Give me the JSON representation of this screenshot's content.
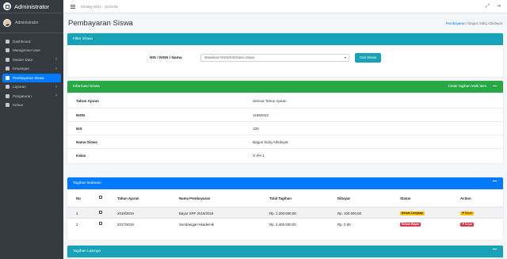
{
  "sidebar": {
    "brand": "Administrator",
    "user": "Administrator",
    "items": [
      {
        "label": "Dashboard",
        "has_chevron": false
      },
      {
        "label": "Manajemen User",
        "has_chevron": false
      },
      {
        "label": "Master Data",
        "has_chevron": true
      },
      {
        "label": "Keuangan",
        "has_chevron": true
      },
      {
        "label": "Pembayaran Siswa",
        "has_chevron": false,
        "active": true
      },
      {
        "label": "Laporan",
        "has_chevron": true
      },
      {
        "label": "Pengaturan",
        "has_chevron": true
      },
      {
        "label": "Keluar",
        "has_chevron": false
      }
    ]
  },
  "topbar": {
    "datetime": "28-May-2021 - 19:04:08",
    "expand_icon": "⤢",
    "logout_icon": "⇥"
  },
  "page": {
    "title": "Pembayaran Siswa",
    "breadcrumb_link": "Pembayaran",
    "breadcrumb_sep": "/",
    "breadcrumb_current": "Bagus Sidiq Athidayat"
  },
  "filter": {
    "header": "Filter Siswa",
    "label": "NIS / NISN / Nama",
    "placeholder": "Masukkan NISN/NIS/Nama Siswa",
    "button": "Cari Siswa"
  },
  "info": {
    "header": "Informasi Siswa",
    "action": "Cetak Tagihan Multi Item",
    "rows": [
      {
        "label": "Tahun Ajaran",
        "value": "Semua Tahun Ajaran"
      },
      {
        "label": "NISN",
        "value": "11982022"
      },
      {
        "label": "NIS",
        "value": "100"
      },
      {
        "label": "Nama Siswa",
        "value": "Bagus Sidiq Athidayat"
      },
      {
        "label": "Kelas",
        "value": "X IPA 1"
      }
    ]
  },
  "tagihan": {
    "header": "Tagihan Bulanan",
    "columns": [
      "No",
      "",
      "Tahun Ajaran",
      "Nama Pembayaran",
      "Total Tagihan",
      "Dibayar",
      "Status",
      "Action"
    ],
    "rows": [
      {
        "no": "1",
        "tahun": "2018/2019",
        "nama": "Bayar SPP 2018/2019",
        "total": "Rp. 1.200.000,00",
        "dibayar": "Rp. 100.000,00",
        "status": "Belum Lengkap",
        "status_type": "warn",
        "action": "Bayar",
        "action_type": "warn"
      },
      {
        "no": "2",
        "tahun": "2017/2018",
        "nama": "Sumbangan Akademik",
        "total": "Rp. 3.400.000,00",
        "dibayar": "Rp. 0,00",
        "status": "Belum Bayar",
        "status_type": "danger",
        "action": "Bayar",
        "action_type": "danger"
      }
    ]
  },
  "lainnya": {
    "header": "Tagihan Lainnya"
  },
  "colors": {
    "sidebar": "#343a40",
    "primary": "#007bff",
    "info": "#17a2b8",
    "success": "#28a745",
    "warning": "#ffc107",
    "danger": "#dc3545"
  }
}
